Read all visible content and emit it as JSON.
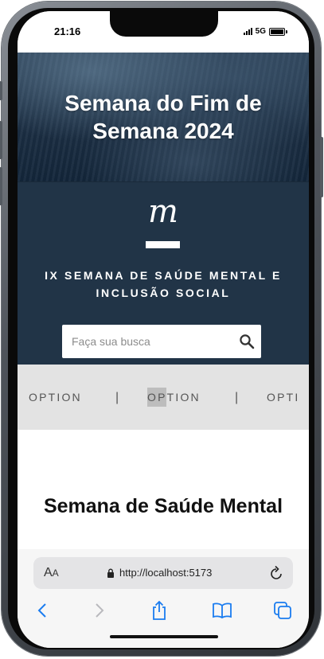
{
  "status_bar": {
    "time": "21:16",
    "network": "5G"
  },
  "hero": {
    "title": "Semana do Fim de Semana 2024"
  },
  "brand": {
    "logo_letter": "m",
    "subtitle": "IX SEMANA DE SAÚDE MENTAL E INCLUSÃO SOCIAL"
  },
  "search": {
    "placeholder": "Faça sua busca",
    "value": ""
  },
  "options_bar": {
    "items": [
      "OPTION",
      "OPTION",
      "OPTI"
    ],
    "separators": [
      "|",
      "|"
    ]
  },
  "main": {
    "section_title": "Semana de Saúde Mental"
  },
  "browser": {
    "text_size_label_big": "A",
    "text_size_label_small": "A",
    "url": "http://localhost:5173"
  },
  "colors": {
    "hero_overlay": "#1c2f44",
    "brand_background": "#213447",
    "options_background": "#e3e3e3",
    "ios_tint": "#1a7cf0"
  },
  "icons": [
    "search-icon",
    "lock-icon",
    "reload-icon",
    "back-icon",
    "forward-icon",
    "share-icon",
    "bookmarks-icon",
    "tabs-icon"
  ]
}
